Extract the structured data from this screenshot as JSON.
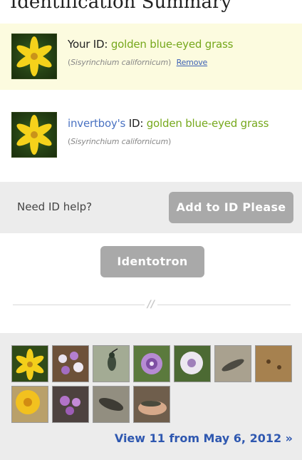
{
  "heading": "Identification Summary",
  "your_id": {
    "owner": "Your ID",
    "common_name": "golden blue-eyed grass",
    "scientific_name": "Sisyrinchium californicum",
    "remove_label": "Remove"
  },
  "other_id": {
    "owner": "invertboy's",
    "owner_suffix": " ID",
    "common_name": "golden blue-eyed grass",
    "scientific_name": "Sisyrinchium californicum"
  },
  "help": {
    "label": "Need ID help?",
    "add_button": "Add to ID Please",
    "identotron_button": "Identotron"
  },
  "photos": {
    "view_link": "View 11 from May 6, 2012 »",
    "items": [
      {
        "icon": "yellow-flower-photo"
      },
      {
        "icon": "purple-flowers-photo"
      },
      {
        "icon": "hummingbird-photo"
      },
      {
        "icon": "purple-flower-photo"
      },
      {
        "icon": "white-flower-photo"
      },
      {
        "icon": "lizard-photo"
      },
      {
        "icon": "ground-insect-photo"
      },
      {
        "icon": "yellow-flower-photo"
      },
      {
        "icon": "purple-flowers-photo"
      },
      {
        "icon": "lizard-photo"
      },
      {
        "icon": "hand-lizard-photo"
      }
    ]
  }
}
